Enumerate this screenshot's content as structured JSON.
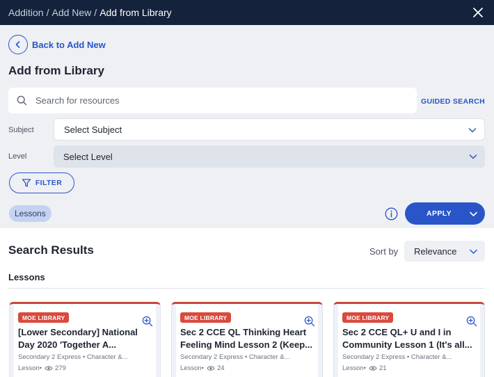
{
  "breadcrumb": [
    "Addition",
    "Add New",
    "Add from Library"
  ],
  "back_label": "Back to Add New",
  "heading": "Add from Library",
  "search": {
    "placeholder": "Search for resources",
    "value": ""
  },
  "guided_search_label": "GUIDED SEARCH",
  "subject": {
    "label": "Subject",
    "value": "Select Subject"
  },
  "level": {
    "label": "Level",
    "value": "Select Level"
  },
  "filter_label": "FILTER",
  "chips": [
    "Lessons"
  ],
  "apply_label": "APPLY",
  "results": {
    "title": "Search Results",
    "sort_label": "Sort by",
    "sort_value": "Relevance",
    "section_label": "Lessons",
    "cards": [
      {
        "badge": "MOE LIBRARY",
        "title": "[Lower Secondary] National\nDay 2020 'Together A...",
        "meta": "Secondary 2 Express • Character &...",
        "type": "Lesson",
        "views": "279"
      },
      {
        "badge": "MOE LIBRARY",
        "title": "Sec 2 CCE QL Thinking Heart\nFeeling Mind Lesson 2 (Keep...",
        "meta": "Secondary 2 Express • Character &...",
        "type": "Lesson",
        "views": "24"
      },
      {
        "badge": "MOE LIBRARY",
        "title": "Sec 2 CCE QL+ U and I in\nCommunity Lesson 1 (It's all...",
        "meta": "Secondary 2 Express • Character &...",
        "type": "Lesson",
        "views": "21"
      }
    ]
  },
  "colors": {
    "primary": "#2a55c8",
    "header": "#14223b",
    "badge": "#d94a3d",
    "panel": "#eef0f4"
  },
  "icons": {
    "close": "close-icon",
    "back": "chevron-left-icon",
    "search": "search-icon",
    "filter": "filter-icon",
    "info": "info-icon",
    "zoom": "zoom-in-icon",
    "views": "eye-icon"
  }
}
